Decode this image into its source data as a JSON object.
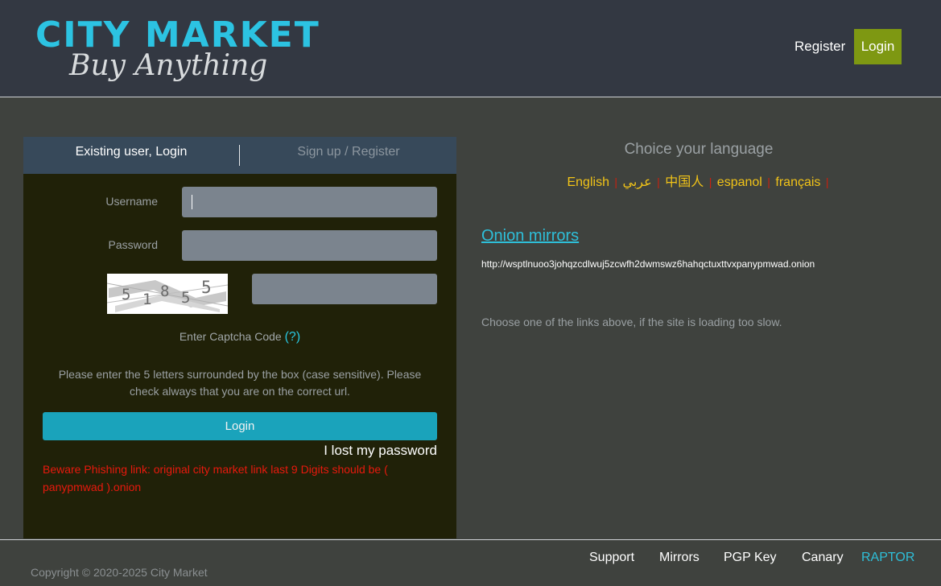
{
  "header": {
    "logo_title": "CITY MARKET",
    "logo_subtitle": "Buy Anything",
    "nav_register": "Register",
    "nav_login": "Login"
  },
  "login_panel": {
    "tab_existing": "Existing user, Login",
    "tab_signup": "Sign up / Register",
    "username_label": "Username",
    "username_value": "",
    "password_label": "Password",
    "password_value": "",
    "captcha_digits": [
      "5",
      "1",
      "8",
      "5",
      "5"
    ],
    "captcha_input_value": "",
    "captcha_label": "Enter Captcha Code",
    "captcha_help": "(?)",
    "instructions": "Please enter the 5 letters surrounded by the box (case sensitive). Please check always that you are on the correct url.",
    "login_button": "Login",
    "lost_password": "I lost my password",
    "warning": "Beware Phishing link: original city market link last 9 Digits should be ( panypmwad ).onion"
  },
  "languages": {
    "title": "Choice your language",
    "items": [
      "English",
      "عربي",
      "中国人",
      "espanol",
      "français"
    ],
    "separator": "|"
  },
  "mirrors": {
    "heading": "Onion mirrors",
    "link": "http://wsptlnuoo3johqzcdlwuj5zcwfh2dwmswz6hahqctuxttvxpanypmwad.onion",
    "note": "Choose one of the links above, if the site is loading too slow."
  },
  "footer": {
    "nav": [
      "Support",
      "Mirrors",
      "PGP Key",
      "Canary",
      "RAPTOR"
    ],
    "copyright": "Copyright © 2020-2025 City Market"
  },
  "colors": {
    "brand_cyan": "#2cc3e2",
    "login_green": "#7e9812",
    "button_teal": "#1aa3bb",
    "warning_red": "#e8190d",
    "language_yellow": "#f1c318",
    "raptor_cyan": "#2ebfd9"
  }
}
